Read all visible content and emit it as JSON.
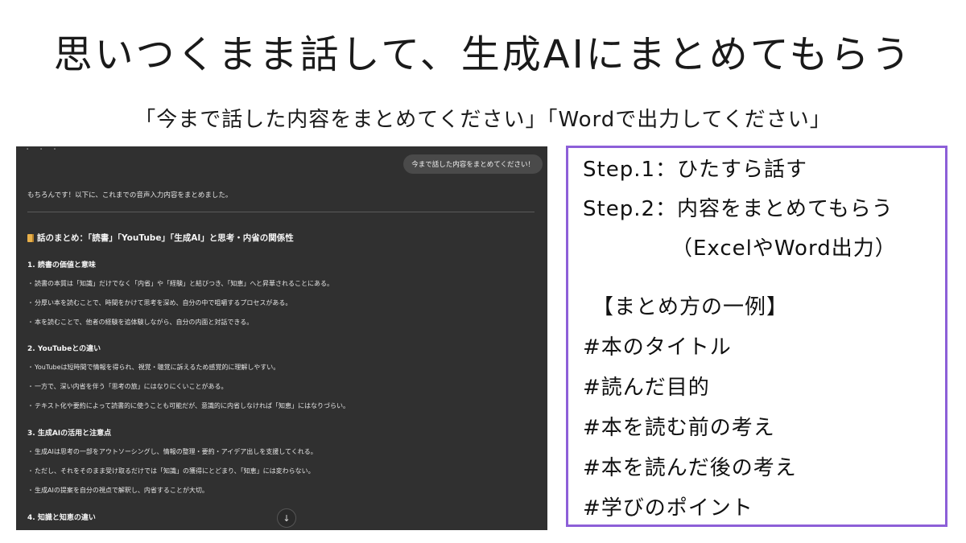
{
  "header": {
    "title": "思いつくまま話して、生成AIにまとめてもらう",
    "subtitle": "「今まで話した内容をまとめてください」「Wordで出力してください」"
  },
  "chat": {
    "user_message": "今まで話した内容をまとめてください！",
    "intro": "もちろんです！以下に、これまでの音声入力内容をまとめました。",
    "summary_heading": "話のまとめ：「読書」「YouTube」「生成AI」と思考・内省の関係性",
    "sections": [
      {
        "title": "1. 読書の価値と意味",
        "items": [
          "読書の本質は「知識」だけでなく「内省」や「経験」と結びつき、「知恵」へと昇華されることにある。",
          "分厚い本を読むことで、時間をかけて思考を深め、自分の中で咀嚼するプロセスがある。",
          "本を読むことで、他者の経験を追体験しながら、自分の内面と対話できる。"
        ]
      },
      {
        "title": "2. YouTubeとの違い",
        "items": [
          "YouTubeは短時間で情報を得られ、視覚・聴覚に訴えるため感覚的に理解しやすい。",
          "一方で、深い内省を伴う「思考の旅」にはなりにくいことがある。",
          "テキスト化や要約によって読書的に使うことも可能だが、意識的に内省しなければ「知恵」にはなりづらい。"
        ]
      },
      {
        "title": "3. 生成AIの活用と注意点",
        "items": [
          "生成AIは思考の一部をアウトソーシングし、情報の整理・要約・アイデア出しを支援してくれる。",
          "ただし、それをそのまま受け取るだけでは「知識」の獲得にとどまり、「知恵」には変わらない。",
          "生成AIの提案を自分の視点で解釈し、内省することが大切。"
        ]
      },
      {
        "title": "4. 知識と知恵の違い",
        "items": []
      }
    ],
    "scroll_icon": "arrow-down-icon"
  },
  "steps": {
    "step1": "Step.1：ひたすら話す",
    "step2": "Step.2：内容をまとめてもらう",
    "step2_note": "（ExcelやWord出力）",
    "example_heading": "【まとめ方の一例】",
    "tags": [
      "#本のタイトル",
      "#読んだ目的",
      "#本を読む前の考え",
      "#本を読んだ後の考え",
      "#学びのポイント"
    ]
  },
  "colors": {
    "chat_bg": "#303030",
    "panel_border": "#8d5fd8"
  }
}
